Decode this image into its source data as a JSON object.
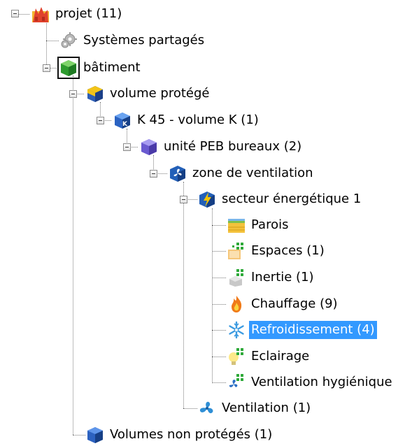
{
  "tree": {
    "projet": "projet (11)",
    "systemes": "Systèmes partagés",
    "batiment": "bâtiment",
    "volume": "volume protégé",
    "k45": "K 45 - volume K (1)",
    "unite": "unité PEB bureaux (2)",
    "zone": "zone de ventilation",
    "secteur": "secteur énergétique 1",
    "parois": "Parois",
    "espaces": "Espaces (1)",
    "inertie": "Inertie (1)",
    "chauffage": "Chauffage (9)",
    "refroid": "Refroidissement (4)",
    "eclairage": "Eclairage",
    "ventil_hyg": "Ventilation hygiénique",
    "ventilation": "Ventilation (1)",
    "non_proteges": "Volumes non protégés (1)",
    "selected_item": "Refroidissement (4)"
  },
  "icons": {
    "projet": "project-building-icon",
    "systemes": "gear-icon",
    "batiment": "green-cube-icon",
    "volume": "blue-yellow-cube-icon",
    "k45": "k-cube-icon",
    "unite": "purple-cube-icon",
    "zone": "fan-cube-icon",
    "secteur": "lightning-cube-icon",
    "parois": "wall-icon",
    "espaces": "spaces-icon",
    "inertie": "inertia-icon",
    "chauffage": "flame-icon",
    "refroid": "snowflake-icon",
    "eclairage": "bulb-icon",
    "ventil_hyg": "hygienic-ventilation-icon",
    "ventilation": "fan-icon",
    "non_proteges": "blue-cube-icon"
  },
  "colors": {
    "selection": "#3399ff",
    "selection_text": "#ffffff"
  }
}
